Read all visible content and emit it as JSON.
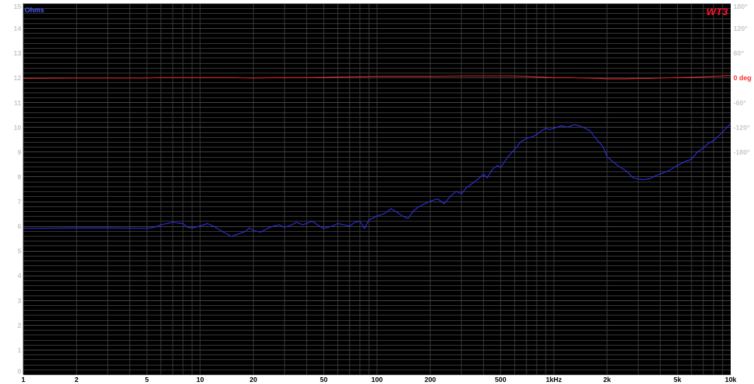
{
  "chart_data": {
    "type": "line",
    "brand": "WT3",
    "left_axis_title": "Ohms",
    "x_scale": "log",
    "xlim": [
      1,
      10000
    ],
    "x_ticks": [
      {
        "v": 1,
        "label": "1"
      },
      {
        "v": 2,
        "label": "2"
      },
      {
        "v": 5,
        "label": "5"
      },
      {
        "v": 10,
        "label": "10"
      },
      {
        "v": 20,
        "label": "20"
      },
      {
        "v": 50,
        "label": "50"
      },
      {
        "v": 100,
        "label": "100"
      },
      {
        "v": 200,
        "label": "200"
      },
      {
        "v": 500,
        "label": "500"
      },
      {
        "v": 1000,
        "label": "1kHz"
      },
      {
        "v": 2000,
        "label": "2k"
      },
      {
        "v": 5000,
        "label": "5k"
      },
      {
        "v": 10000,
        "label": "10k"
      }
    ],
    "ylim_left": [
      0,
      15
    ],
    "y_ticks_left": [
      "0",
      "1",
      "2",
      "3",
      "4",
      "5",
      "6",
      "7",
      "8",
      "9",
      "10",
      "11",
      "12",
      "13",
      "14",
      "15"
    ],
    "phase_zero_ohm": 12,
    "ohm_per_degree": 0.016667,
    "y_ticks_right": [
      {
        "deg": 180,
        "label": "180°"
      },
      {
        "deg": 120,
        "label": "120°"
      },
      {
        "deg": 60,
        "label": "60°"
      },
      {
        "deg": 0,
        "label": "0 deg"
      },
      {
        "deg": -60,
        "label": "-60°"
      },
      {
        "deg": -120,
        "label": "-120°"
      },
      {
        "deg": -180,
        "label": "-180°"
      }
    ],
    "grid": true,
    "colors": {
      "background": "#000000",
      "grid": "#3c3c3c",
      "impedance": "#3030e8",
      "phase": "#e02020",
      "left_ticks": "#c8c8c8",
      "left_title": "#4a5cff",
      "right_ticks": "#c8c8c8",
      "right_zero": "#ff3030",
      "x_ticks": "#000000",
      "brand": "#ff1030"
    },
    "series": [
      {
        "key": "impedance",
        "unit": "ohm",
        "points": [
          [
            1,
            5.9
          ],
          [
            2,
            5.92
          ],
          [
            3,
            5.92
          ],
          [
            4,
            5.91
          ],
          [
            5,
            5.9
          ],
          [
            5.5,
            5.95
          ],
          [
            6,
            6.05
          ],
          [
            7,
            6.15
          ],
          [
            8,
            6.1
          ],
          [
            8.5,
            5.95
          ],
          [
            9,
            5.92
          ],
          [
            10,
            6.0
          ],
          [
            11,
            6.1
          ],
          [
            12,
            5.98
          ],
          [
            13,
            5.82
          ],
          [
            14,
            5.7
          ],
          [
            15,
            5.58
          ],
          [
            16,
            5.65
          ],
          [
            18,
            5.78
          ],
          [
            19,
            5.92
          ],
          [
            20,
            5.82
          ],
          [
            22,
            5.75
          ],
          [
            24,
            5.9
          ],
          [
            26,
            6.0
          ],
          [
            28,
            6.05
          ],
          [
            30,
            5.95
          ],
          [
            33,
            6.05
          ],
          [
            35,
            6.15
          ],
          [
            38,
            6.05
          ],
          [
            40,
            6.1
          ],
          [
            43,
            6.2
          ],
          [
            46,
            6.05
          ],
          [
            50,
            5.9
          ],
          [
            55,
            5.98
          ],
          [
            60,
            6.1
          ],
          [
            65,
            6.05
          ],
          [
            70,
            6.0
          ],
          [
            75,
            6.15
          ],
          [
            80,
            6.2
          ],
          [
            85,
            5.9
          ],
          [
            90,
            6.25
          ],
          [
            100,
            6.4
          ],
          [
            110,
            6.5
          ],
          [
            120,
            6.7
          ],
          [
            130,
            6.55
          ],
          [
            140,
            6.4
          ],
          [
            150,
            6.3
          ],
          [
            160,
            6.6
          ],
          [
            170,
            6.75
          ],
          [
            180,
            6.85
          ],
          [
            200,
            7.0
          ],
          [
            220,
            7.1
          ],
          [
            240,
            6.9
          ],
          [
            260,
            7.2
          ],
          [
            280,
            7.4
          ],
          [
            300,
            7.3
          ],
          [
            320,
            7.55
          ],
          [
            350,
            7.75
          ],
          [
            380,
            7.95
          ],
          [
            400,
            8.1
          ],
          [
            420,
            7.95
          ],
          [
            450,
            8.3
          ],
          [
            480,
            8.45
          ],
          [
            500,
            8.35
          ],
          [
            550,
            8.8
          ],
          [
            600,
            9.1
          ],
          [
            650,
            9.4
          ],
          [
            700,
            9.55
          ],
          [
            750,
            9.6
          ],
          [
            800,
            9.7
          ],
          [
            850,
            9.85
          ],
          [
            900,
            9.95
          ],
          [
            950,
            9.9
          ],
          [
            1000,
            9.95
          ],
          [
            1100,
            10.05
          ],
          [
            1200,
            10.0
          ],
          [
            1300,
            10.1
          ],
          [
            1400,
            10.05
          ],
          [
            1500,
            9.95
          ],
          [
            1600,
            9.85
          ],
          [
            1700,
            9.6
          ],
          [
            1800,
            9.4
          ],
          [
            1900,
            9.2
          ],
          [
            2000,
            8.8
          ],
          [
            2200,
            8.55
          ],
          [
            2400,
            8.35
          ],
          [
            2600,
            8.2
          ],
          [
            2800,
            7.95
          ],
          [
            3000,
            7.9
          ],
          [
            3200,
            7.88
          ],
          [
            3500,
            7.92
          ],
          [
            3800,
            8.05
          ],
          [
            4000,
            8.1
          ],
          [
            4500,
            8.25
          ],
          [
            5000,
            8.45
          ],
          [
            5500,
            8.6
          ],
          [
            6000,
            8.7
          ],
          [
            6500,
            9.0
          ],
          [
            7000,
            9.15
          ],
          [
            7500,
            9.35
          ],
          [
            8000,
            9.45
          ],
          [
            9000,
            9.8
          ],
          [
            10000,
            10.15
          ]
        ]
      },
      {
        "key": "phase",
        "unit": "deg",
        "points": [
          [
            1,
            -2
          ],
          [
            2,
            -1
          ],
          [
            3,
            -1
          ],
          [
            5,
            -1
          ],
          [
            6,
            0
          ],
          [
            7,
            0
          ],
          [
            8,
            0
          ],
          [
            10,
            0
          ],
          [
            15,
            0
          ],
          [
            20,
            -1
          ],
          [
            30,
            0
          ],
          [
            40,
            0
          ],
          [
            50,
            1
          ],
          [
            70,
            2
          ],
          [
            100,
            3
          ],
          [
            150,
            3
          ],
          [
            200,
            3
          ],
          [
            300,
            4
          ],
          [
            400,
            4
          ],
          [
            500,
            4
          ],
          [
            600,
            4
          ],
          [
            700,
            3
          ],
          [
            800,
            2
          ],
          [
            900,
            1
          ],
          [
            1000,
            0
          ],
          [
            1200,
            0
          ],
          [
            1500,
            -1
          ],
          [
            1800,
            -2
          ],
          [
            2000,
            -3
          ],
          [
            2300,
            -3
          ],
          [
            2600,
            -3
          ],
          [
            3000,
            -2
          ],
          [
            3500,
            -2
          ],
          [
            4000,
            -1
          ],
          [
            5000,
            0
          ],
          [
            6000,
            1
          ],
          [
            7000,
            2
          ],
          [
            8000,
            3
          ],
          [
            9000,
            4
          ],
          [
            10000,
            5
          ]
        ]
      }
    ]
  }
}
